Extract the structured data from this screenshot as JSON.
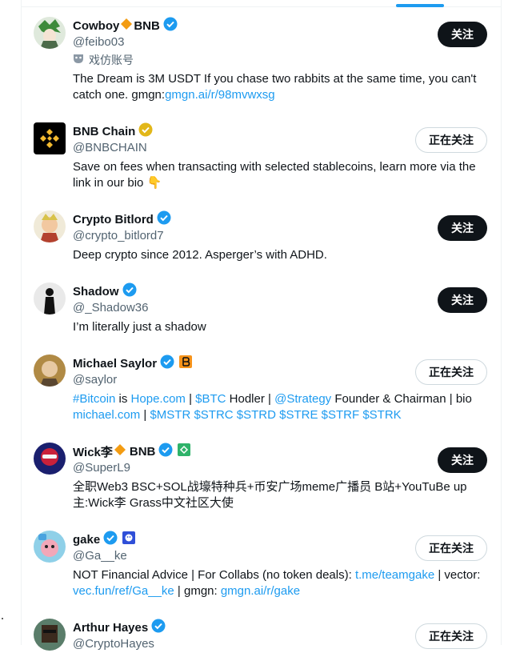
{
  "list": {
    "users": [
      {
        "name": "Cowboy",
        "name_suffix": "BNB",
        "handle": "@feibo03",
        "parody_label": "戏仿账号",
        "bio_text": "The Dream is 3M USDT If you chase two rabbits at the same time, you can't catch one. gmgn:",
        "bio_link": "gmgn.ai/r/98mvwxsg",
        "button": "关注",
        "verified": "blue"
      },
      {
        "name": "BNB Chain",
        "handle": "@BNBCHAIN",
        "bio_text": "Save on fees when transacting with selected stablecoins, learn more via the link in our bio 👇",
        "button": "正在关注",
        "verified": "gold"
      },
      {
        "name": "Crypto Bitlord",
        "handle": "@crypto_bitlord7",
        "bio_text": "Deep crypto since 2012. Asperger’s with ADHD.",
        "button": "关注",
        "verified": "blue"
      },
      {
        "name": "Shadow",
        "handle": "@_Shadow36",
        "bio_text": "I’m literally just a shadow",
        "button": "关注",
        "verified": "blue"
      },
      {
        "name": "Michael Saylor",
        "handle": "@saylor",
        "bio_parts": [
          "#Bitcoin",
          " is ",
          "Hope.com",
          " | ",
          "$BTC",
          " Hodler | ",
          "@Strategy",
          " Founder & Chairman | bio ",
          "michael.com",
          " | ",
          "$MSTR $STRC $STRD $STRE $STRF $STRK"
        ],
        "button": "正在关注",
        "verified": "blue"
      },
      {
        "name": "Wick李",
        "name_suffix": "BNB",
        "handle": "@SuperL9",
        "bio_text": "全职Web3 BSC+SOL战壕特种兵+币安广场meme广播员 B站+YouTuBe up主:Wick李 Grass中文社区大使",
        "button": "关注",
        "verified": "blue"
      },
      {
        "name": "gake",
        "handle": "@Ga__ke",
        "bio_parts": [
          "NOT Financial Advice | For Collabs (no token deals): ",
          "t.me/teamgake",
          " | vector: ",
          "vec.fun/ref/Ga__ke",
          " | gmgn: ",
          "gmgn.ai/r/gake"
        ],
        "button": "正在关注",
        "verified": "blue"
      },
      {
        "name": "Arthur Hayes",
        "handle": "@CryptoHayes",
        "button": "正在关注",
        "verified": "blue"
      }
    ]
  },
  "colors": {
    "accent": "#1d9bf0",
    "text": "#0f1419",
    "muted": "#536471",
    "gold": "#e2b719",
    "bnb": "#f3ba2f"
  }
}
